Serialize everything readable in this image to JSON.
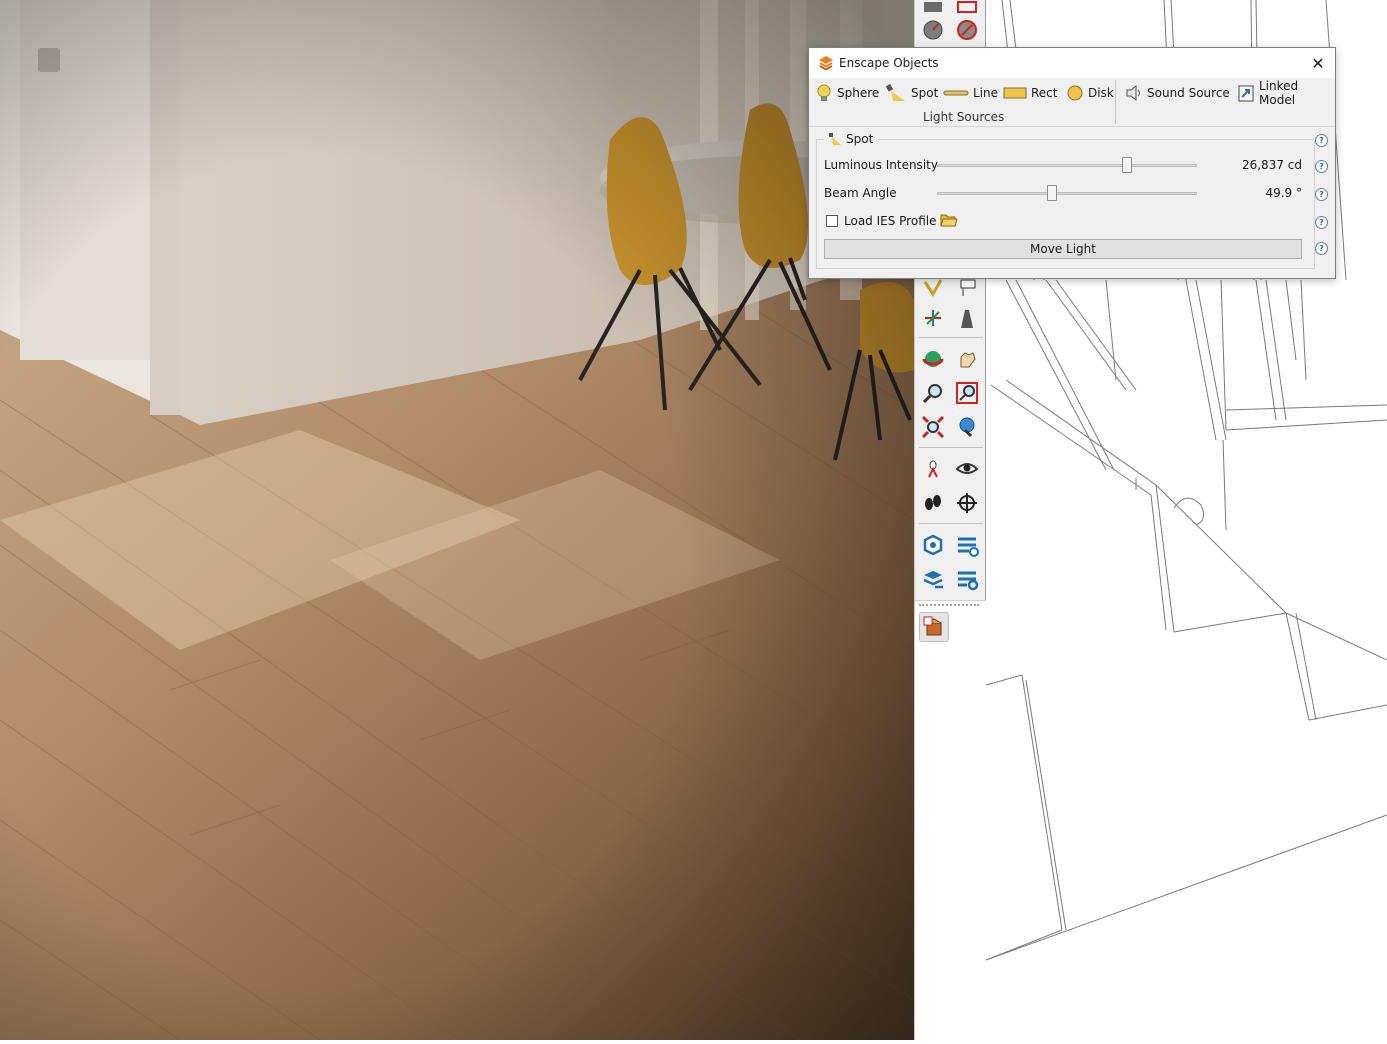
{
  "dialog": {
    "title": "Enscape Objects",
    "close_glyph": "✕",
    "objects": [
      {
        "label": "Sphere",
        "icon": "bulb-icon"
      },
      {
        "label": "Spot",
        "icon": "spot-light-icon"
      },
      {
        "label": "Line",
        "icon": "line-light-icon"
      },
      {
        "label": "Rect",
        "icon": "rect-light-icon"
      },
      {
        "label": "Disk",
        "icon": "disk-light-icon"
      },
      {
        "label": "Sound Source",
        "icon": "speaker-icon"
      },
      {
        "label": "Linked Model",
        "icon": "linked-model-icon"
      }
    ],
    "group_label": "Light Sources",
    "section": {
      "title": "Spot",
      "luminous_label": "Luminous Intensity",
      "luminous_value": "26,837 cd",
      "luminous_fraction": 0.74,
      "beam_label": "Beam Angle",
      "beam_value": "49.9 °",
      "beam_fraction": 0.44,
      "ies_label": "Load IES Profile",
      "ies_checked": false,
      "move_label": "Move Light",
      "help_glyph": "?"
    }
  },
  "toolbar": {
    "tools": [
      "protractor-icon",
      "protractor-alt-icon",
      "paint-icon",
      "label-icon",
      "axes-icon",
      "section-icon",
      "orbit-icon",
      "pan-icon",
      "zoom-icon",
      "zoom-window-icon",
      "zoom-extents-icon",
      "previous-view-icon",
      "position-camera-icon",
      "look-around-icon",
      "walk-icon",
      "position-target-icon",
      "warehouse-icon",
      "share-model-icon",
      "layers-upload-icon",
      "extension-icon",
      "extension-settings-icon",
      "enscape-objects-icon"
    ]
  },
  "colors": {
    "accent_orange": "#e8821e",
    "dialog_bg": "#f0f0f0",
    "help_blue": "#3a6194"
  }
}
